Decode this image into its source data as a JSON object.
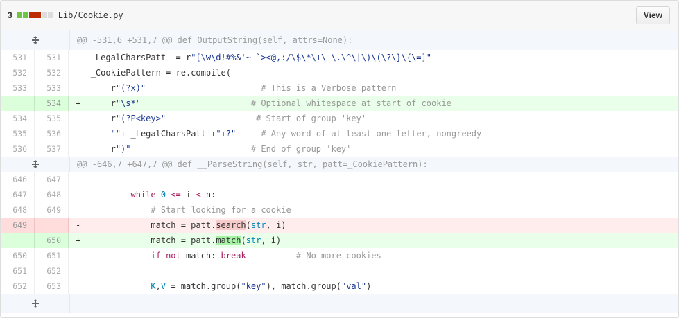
{
  "file": {
    "change_count": "3",
    "diffstat_colors": [
      "#6cc644",
      "#6cc644",
      "#bd2c00",
      "#bd2c00",
      "#ddd",
      "#ddd"
    ],
    "path": "Lib/Cookie.py",
    "view_label": "View"
  },
  "hunks": [
    {
      "header": "@@ -531,6 +531,7 @@ def OutputString(self, attrs=None):"
    },
    {
      "header": "@@ -646,7 +647,7 @@ def __ParseString(self, str, patt=_CookiePattern):"
    }
  ],
  "lines": [
    {
      "old": "531",
      "new": "531",
      "sign": " ",
      "type": "ctx",
      "parts": [
        [
          "",
          "_LegalCharsPatt  = r"
        ],
        [
          "s",
          "\"[\\w\\d!#%&'~_`><@,:/\\$\\*\\+\\-\\.\\^\\|\\)\\(\\?\\}\\{\\=]\""
        ]
      ]
    },
    {
      "old": "532",
      "new": "532",
      "sign": " ",
      "type": "ctx",
      "parts": [
        [
          "",
          "_CookiePattern = re.compile("
        ]
      ]
    },
    {
      "old": "533",
      "new": "533",
      "sign": " ",
      "type": "ctx",
      "parts": [
        [
          "",
          "    r"
        ],
        [
          "s",
          "\"(?x)\""
        ],
        [
          "",
          "                       "
        ],
        [
          "c",
          "# This is a Verbose pattern"
        ]
      ]
    },
    {
      "old": "",
      "new": "534",
      "sign": "+",
      "type": "add",
      "parts": [
        [
          "",
          "    r"
        ],
        [
          "s",
          "\"\\s*\""
        ],
        [
          "",
          "                      "
        ],
        [
          "c",
          "# Optional whitespace at start of cookie"
        ]
      ]
    },
    {
      "old": "534",
      "new": "535",
      "sign": " ",
      "type": "ctx",
      "parts": [
        [
          "",
          "    r"
        ],
        [
          "s",
          "\"(?P<key>\""
        ],
        [
          "",
          "                  "
        ],
        [
          "c",
          "# Start of group 'key'"
        ]
      ]
    },
    {
      "old": "535",
      "new": "536",
      "sign": " ",
      "type": "ctx",
      "parts": [
        [
          "",
          "    "
        ],
        [
          "s",
          "\"\""
        ],
        [
          "",
          "+ _LegalCharsPatt +"
        ],
        [
          "s",
          "\"+?\""
        ],
        [
          "",
          "     "
        ],
        [
          "c",
          "# Any word of at least one letter, nongreedy"
        ]
      ]
    },
    {
      "old": "536",
      "new": "537",
      "sign": " ",
      "type": "ctx",
      "parts": [
        [
          "",
          "    r"
        ],
        [
          "s",
          "\")\""
        ],
        [
          "",
          "                        "
        ],
        [
          "c",
          "# End of group 'key'"
        ]
      ]
    }
  ],
  "lines2": [
    {
      "old": "646",
      "new": "647",
      "sign": " ",
      "type": "ctx",
      "parts": [
        [
          "",
          ""
        ]
      ]
    },
    {
      "old": "647",
      "new": "648",
      "sign": " ",
      "type": "ctx",
      "parts": [
        [
          "",
          "        "
        ],
        [
          "k",
          "while"
        ],
        [
          "",
          " "
        ],
        [
          "n",
          "0"
        ],
        [
          "",
          " "
        ],
        [
          "k",
          "<="
        ],
        [
          "",
          " i "
        ],
        [
          "k",
          "<"
        ],
        [
          "",
          " n:"
        ]
      ]
    },
    {
      "old": "648",
      "new": "649",
      "sign": " ",
      "type": "ctx",
      "parts": [
        [
          "",
          "            "
        ],
        [
          "c",
          "# Start looking for a cookie"
        ]
      ]
    },
    {
      "old": "649",
      "new": "",
      "sign": "-",
      "type": "del",
      "parts": [
        [
          "",
          "            match = patt."
        ],
        [
          "hl-del",
          "search"
        ],
        [
          "",
          "("
        ],
        [
          "n",
          "str"
        ],
        [
          "",
          ", i)"
        ]
      ]
    },
    {
      "old": "",
      "new": "650",
      "sign": "+",
      "type": "add",
      "parts": [
        [
          "",
          "            match = patt."
        ],
        [
          "hl-add",
          "match"
        ],
        [
          "",
          "("
        ],
        [
          "n",
          "str"
        ],
        [
          "",
          ", i)"
        ]
      ]
    },
    {
      "old": "650",
      "new": "651",
      "sign": " ",
      "type": "ctx",
      "parts": [
        [
          "",
          "            "
        ],
        [
          "k",
          "if not"
        ],
        [
          "",
          " match: "
        ],
        [
          "k",
          "break"
        ],
        [
          "",
          "          "
        ],
        [
          "c",
          "# No more cookies"
        ]
      ]
    },
    {
      "old": "651",
      "new": "652",
      "sign": " ",
      "type": "ctx",
      "parts": [
        [
          "",
          ""
        ]
      ]
    },
    {
      "old": "652",
      "new": "653",
      "sign": " ",
      "type": "ctx",
      "parts": [
        [
          "",
          "            "
        ],
        [
          "n",
          "K"
        ],
        [
          "",
          ","
        ],
        [
          "n",
          "V"
        ],
        [
          "",
          " = match.group("
        ],
        [
          "s",
          "\"key\""
        ],
        [
          "",
          "), match.group("
        ],
        [
          "s",
          "\"val\""
        ],
        [
          "",
          ")"
        ]
      ]
    }
  ]
}
